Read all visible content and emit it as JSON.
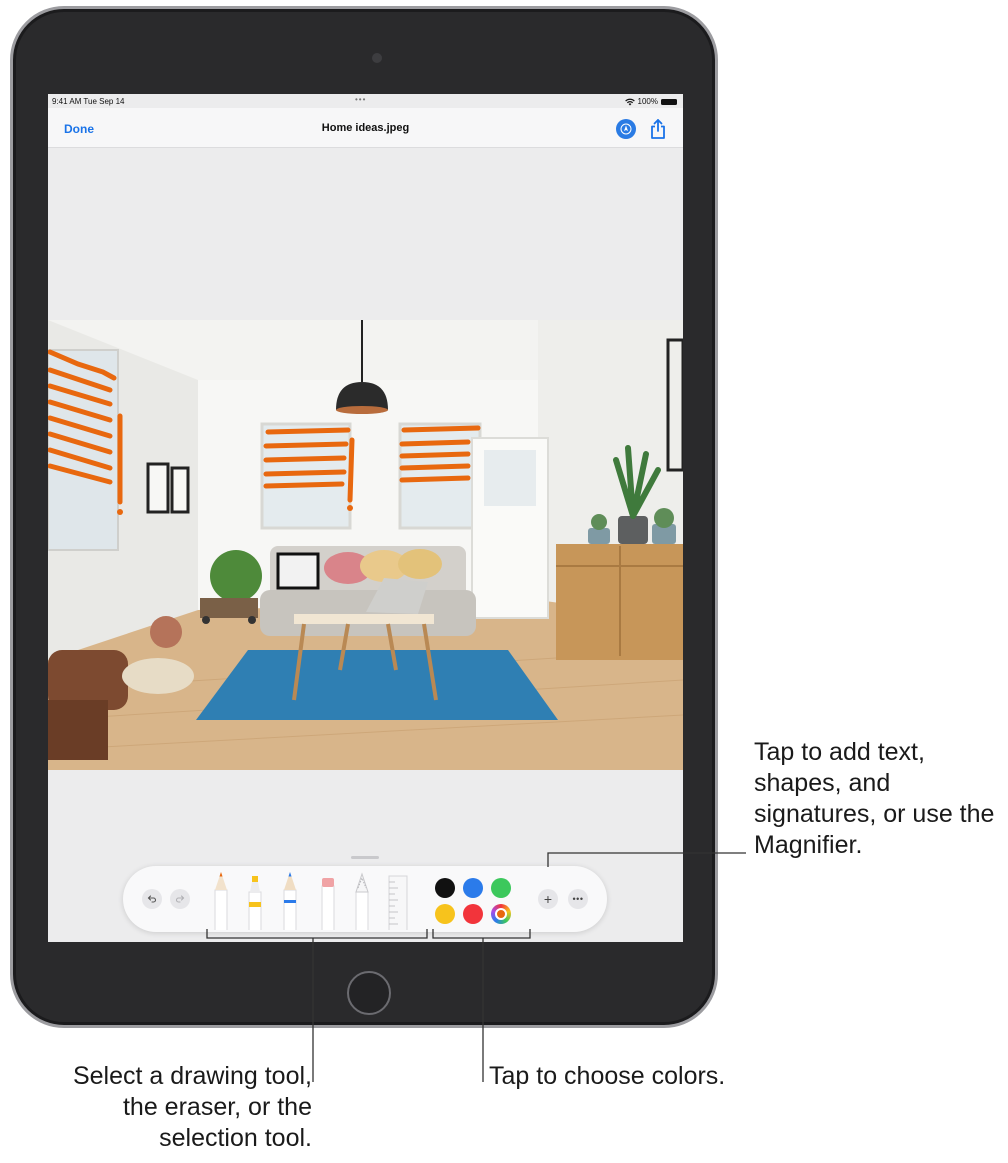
{
  "status_bar": {
    "time": "9:41 AM  Tue Sep 14",
    "dots": "•••",
    "battery_text": "100%",
    "wifi_icon": "wifi-icon",
    "battery_icon": "battery-icon"
  },
  "nav": {
    "done_label": "Done",
    "title": "Home ideas.jpeg",
    "markup_icon": "markup-pen-icon",
    "share_icon": "share-icon"
  },
  "toolbar": {
    "undo_icon": "undo-icon",
    "redo_icon": "redo-icon",
    "tools": [
      "pen",
      "marker",
      "pencil",
      "eraser",
      "lasso",
      "ruler"
    ],
    "colors": [
      "#111111",
      "#2b7bea",
      "#3cc85c",
      "#f7c31c",
      "#f2343b",
      "multicolor"
    ],
    "add_label": "+",
    "more_label": "•••"
  },
  "callouts": {
    "add": "Tap to add text, shapes, and signatures, or use the Magnifier.",
    "drawing": "Select a drawing tool, the eraser, or the selection tool.",
    "colors": "Tap to choose colors."
  },
  "colors": {
    "accent": "#1a73e8",
    "markup_orange": "#e8680f",
    "rug_blue": "#2f7fb3"
  }
}
